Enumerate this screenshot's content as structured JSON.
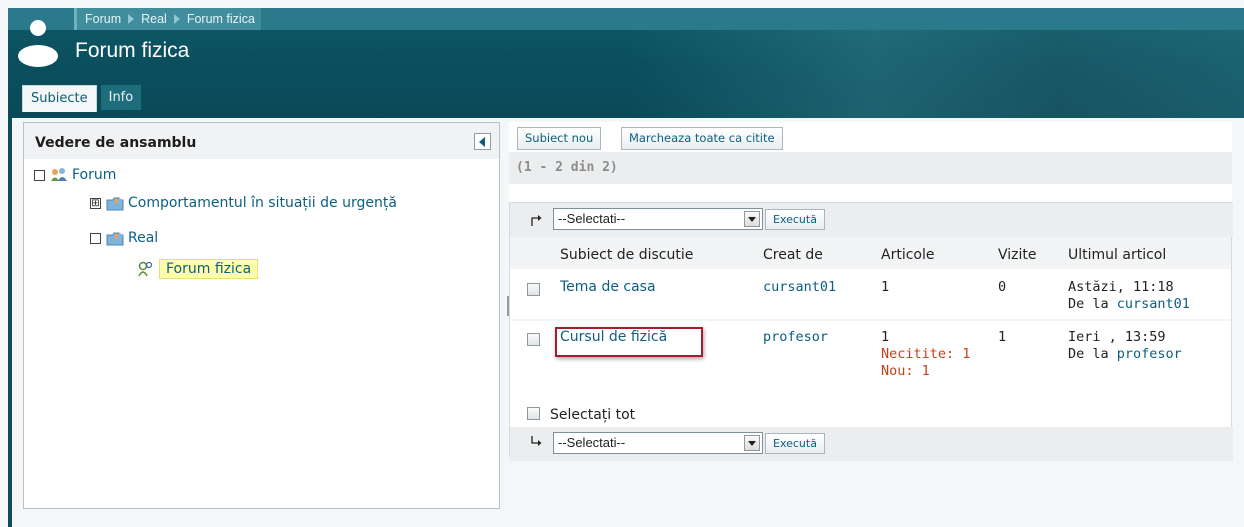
{
  "breadcrumb": [
    "Forum",
    "Real",
    "Forum fizica"
  ],
  "page_title": "Forum fizica",
  "tabs": [
    {
      "label": "Subiecte",
      "active": true
    },
    {
      "label": "Info",
      "active": false
    }
  ],
  "left_panel": {
    "title": "Vedere de ansamblu",
    "tree": {
      "root": {
        "label": "Forum",
        "toggle": "☐"
      },
      "item1": {
        "label": "Comportamentul în situații de urgență",
        "toggle": "⊞"
      },
      "item2": {
        "label": "Real",
        "toggle": "☐"
      },
      "selected": {
        "label": "Forum fizica"
      }
    }
  },
  "toolbar": {
    "new_topic": "Subiect nou",
    "mark_all_read": "Marcheaza toate ca citite"
  },
  "pager": "(1 - 2 din 2)",
  "action": {
    "select_placeholder": "--Selectati--",
    "execute": "Execută"
  },
  "columns": {
    "subject": "Subiect de discutie",
    "created_by": "Creat de",
    "articles": "Articole",
    "visits": "Vizite",
    "last_article": "Ultimul articol"
  },
  "rows": [
    {
      "subject": "Tema de casa",
      "author": "cursant01",
      "articles": "1",
      "visits": "0",
      "last_date": "Astăzi, 11:18",
      "last_from_prefix": "De la",
      "last_from_user": "cursant01"
    },
    {
      "subject": "Cursul de fizică",
      "author": "profesor",
      "articles": "1",
      "unread": "Necitite: 1",
      "new": "Nou: 1",
      "visits": "1",
      "last_date": "Ieri , 13:59",
      "last_from_prefix": "De la",
      "last_from_user": "profesor"
    }
  ],
  "select_all": "Selectați tot",
  "colors": {
    "header": "#0b4f5e",
    "link": "#0d5f80",
    "highlight": "#ffffa8",
    "status_orange": "#c8401a",
    "annotation_box": "#a31d2c"
  }
}
